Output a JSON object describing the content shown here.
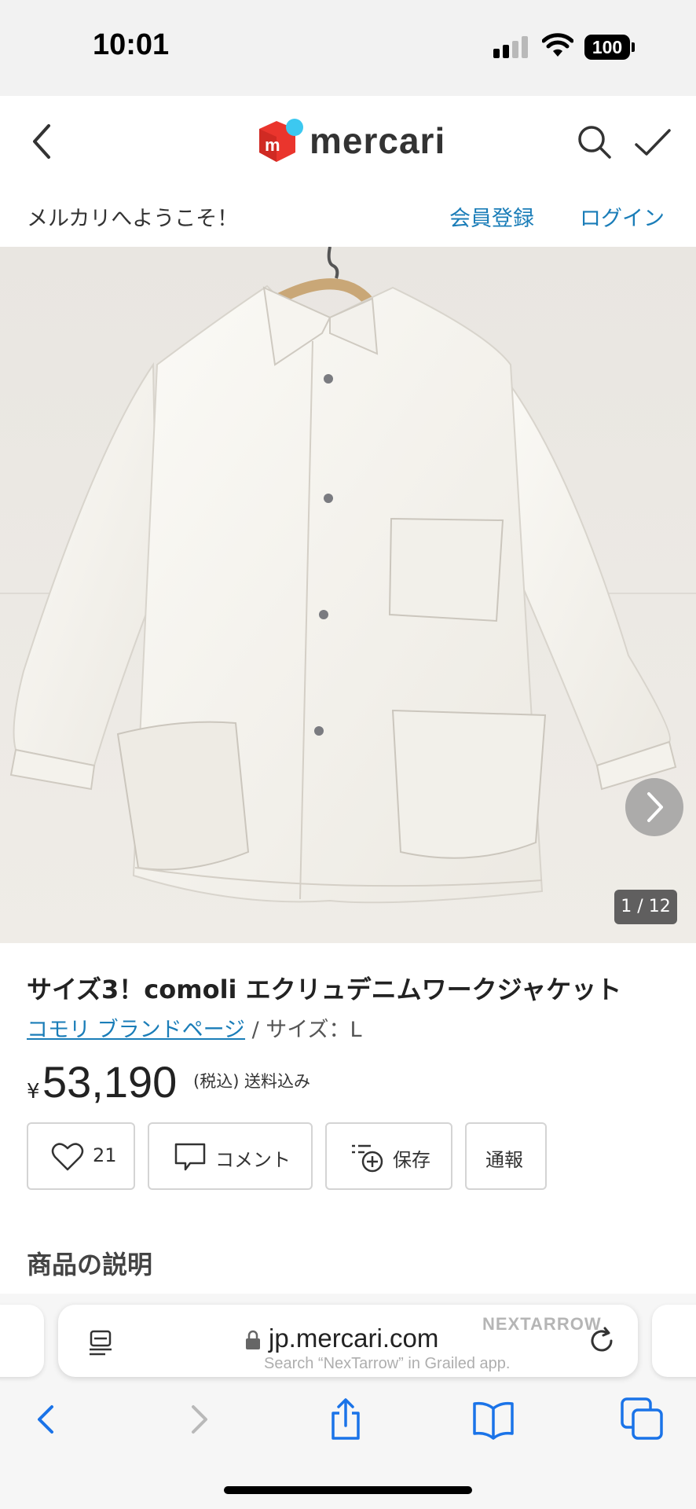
{
  "status_bar": {
    "time": "10:01",
    "battery": "100"
  },
  "header": {
    "logo_text": "mercari",
    "icons": [
      "back-chevron-icon",
      "mercari-cube-logo",
      "search-icon",
      "checkmark-icon"
    ]
  },
  "welcome_bar": {
    "message": "メルカリへようこそ！",
    "register": "会員登録",
    "login": "ログイン"
  },
  "gallery": {
    "counter": "1 / 12",
    "next_icon": "chevron-right-icon"
  },
  "product": {
    "title": "サイズ3！comoli エクリュデニムワークジャケット",
    "brand_link": "コモリ ブランドページ",
    "size_text": " / サイズ：L",
    "currency": "¥",
    "price": "53,190",
    "tax_note": "(税込) 送料込み"
  },
  "actions": {
    "like_count": "21",
    "comment": "コメント",
    "save": "保存",
    "report": "通報"
  },
  "description": {
    "heading": "商品の説明"
  },
  "browser": {
    "url": "jp.mercari.com",
    "watermark_line1": "NEXTARROW",
    "watermark_line2": "Search “NexTarrow” in Grailed app."
  },
  "colors": {
    "accent_link": "#1a7db8",
    "brand_red": "#ea352d",
    "brand_blue": "#3cc8f0",
    "ios_blue": "#1a73e8"
  }
}
